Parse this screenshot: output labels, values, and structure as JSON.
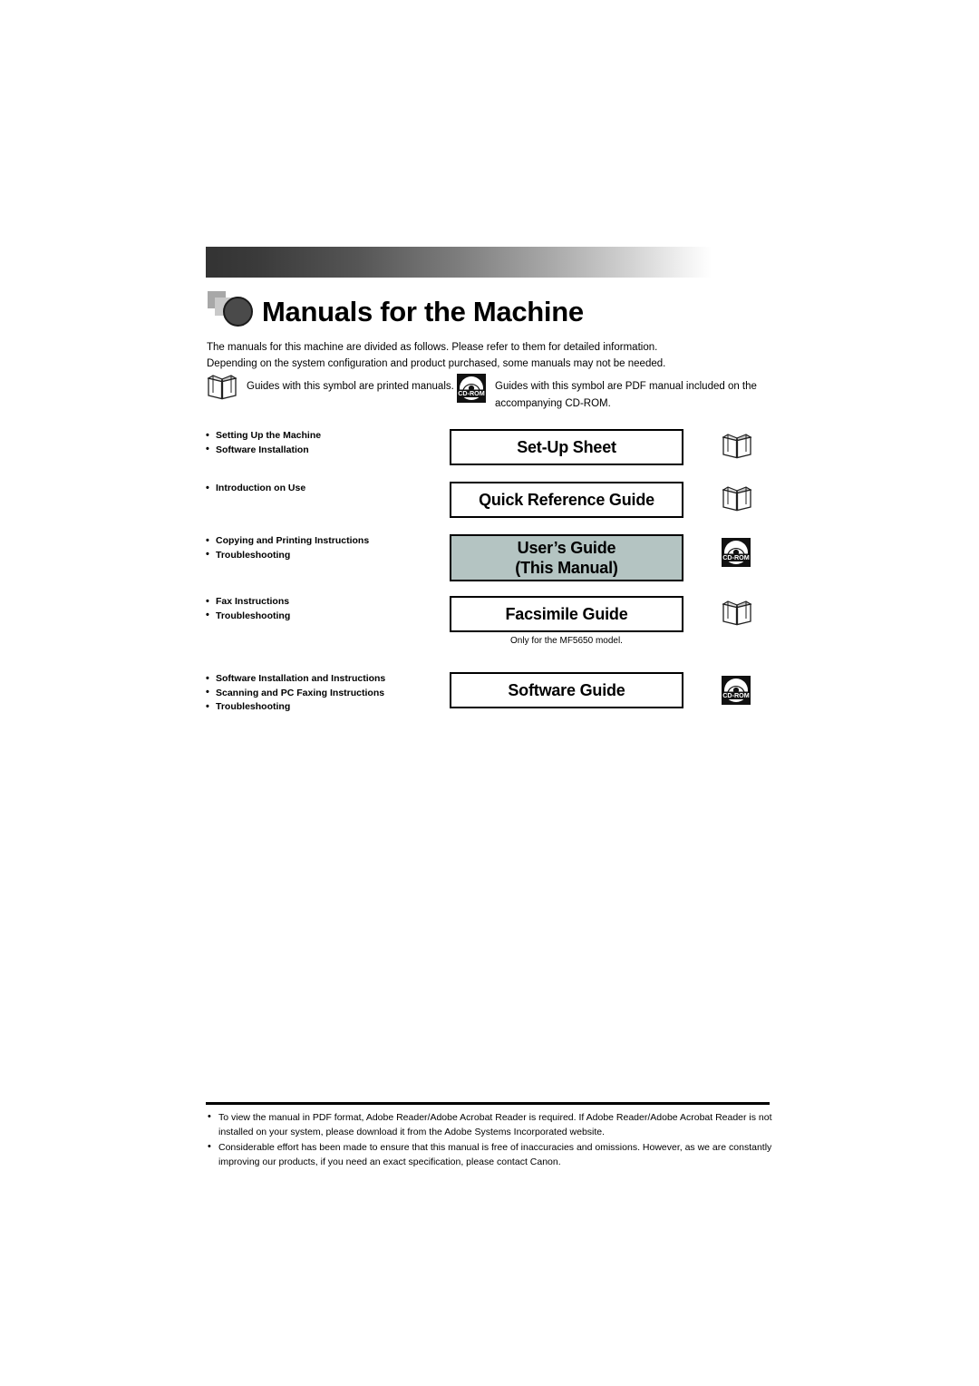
{
  "header": {
    "title": "Manuals for the Machine",
    "logo_icon": "square-circle-logo-icon"
  },
  "intro": {
    "line1": "The manuals for this machine are divided as follows. Please refer to them for detailed information.",
    "line2": "Depending on the system configuration and product purchased, some manuals may not be needed."
  },
  "legend": {
    "printed": {
      "icon": "book-icon",
      "text": "Guides with this symbol are printed manuals."
    },
    "pdf": {
      "icon": "cd-rom-icon",
      "icon_label": "CD-ROM",
      "text_line1": "Guides with this symbol are PDF manual included on the",
      "text_line2": "accompanying CD-ROM."
    }
  },
  "manuals": [
    {
      "topics": [
        "Setting Up the Machine",
        "Software Installation"
      ],
      "title": "Set-Up Sheet",
      "title_line2": "",
      "media": "book-icon",
      "shaded": false,
      "note": ""
    },
    {
      "topics": [
        "Introduction on Use"
      ],
      "title": "Quick Reference Guide",
      "title_line2": "",
      "media": "book-icon",
      "shaded": false,
      "note": ""
    },
    {
      "topics": [
        "Copying and Printing Instructions",
        "Troubleshooting"
      ],
      "title": "User’s Guide",
      "title_line2": "(This Manual)",
      "media": "cd-rom-icon",
      "shaded": true,
      "note": ""
    },
    {
      "topics": [
        "Fax Instructions",
        "Troubleshooting"
      ],
      "title": "Facsimile Guide",
      "title_line2": "",
      "media": "book-icon",
      "shaded": false,
      "note": "Only for the MF5650 model."
    },
    {
      "topics": [
        "Software Installation and Instructions",
        "Scanning and PC Faxing Instructions",
        "Troubleshooting"
      ],
      "title": "Software Guide",
      "title_line2": "",
      "media": "cd-rom-icon",
      "shaded": false,
      "note": ""
    }
  ],
  "footer": {
    "notes": [
      "To view the manual in PDF format, Adobe Reader/Adobe Acrobat Reader is required. If Adobe Reader/Adobe Acrobat Reader is not installed on your system, please download it from the Adobe Systems Incorporated website.",
      "Considerable effort has been made to ensure that this manual is free of inaccuracies and omissions. However, as we are constantly improving our products, if you need an exact specification, please contact Canon."
    ]
  },
  "colors": {
    "shaded_box": "#b4c4c2",
    "band_dark": "#333333",
    "rule": "#000000"
  },
  "cd_rom_label": "CD-ROM"
}
